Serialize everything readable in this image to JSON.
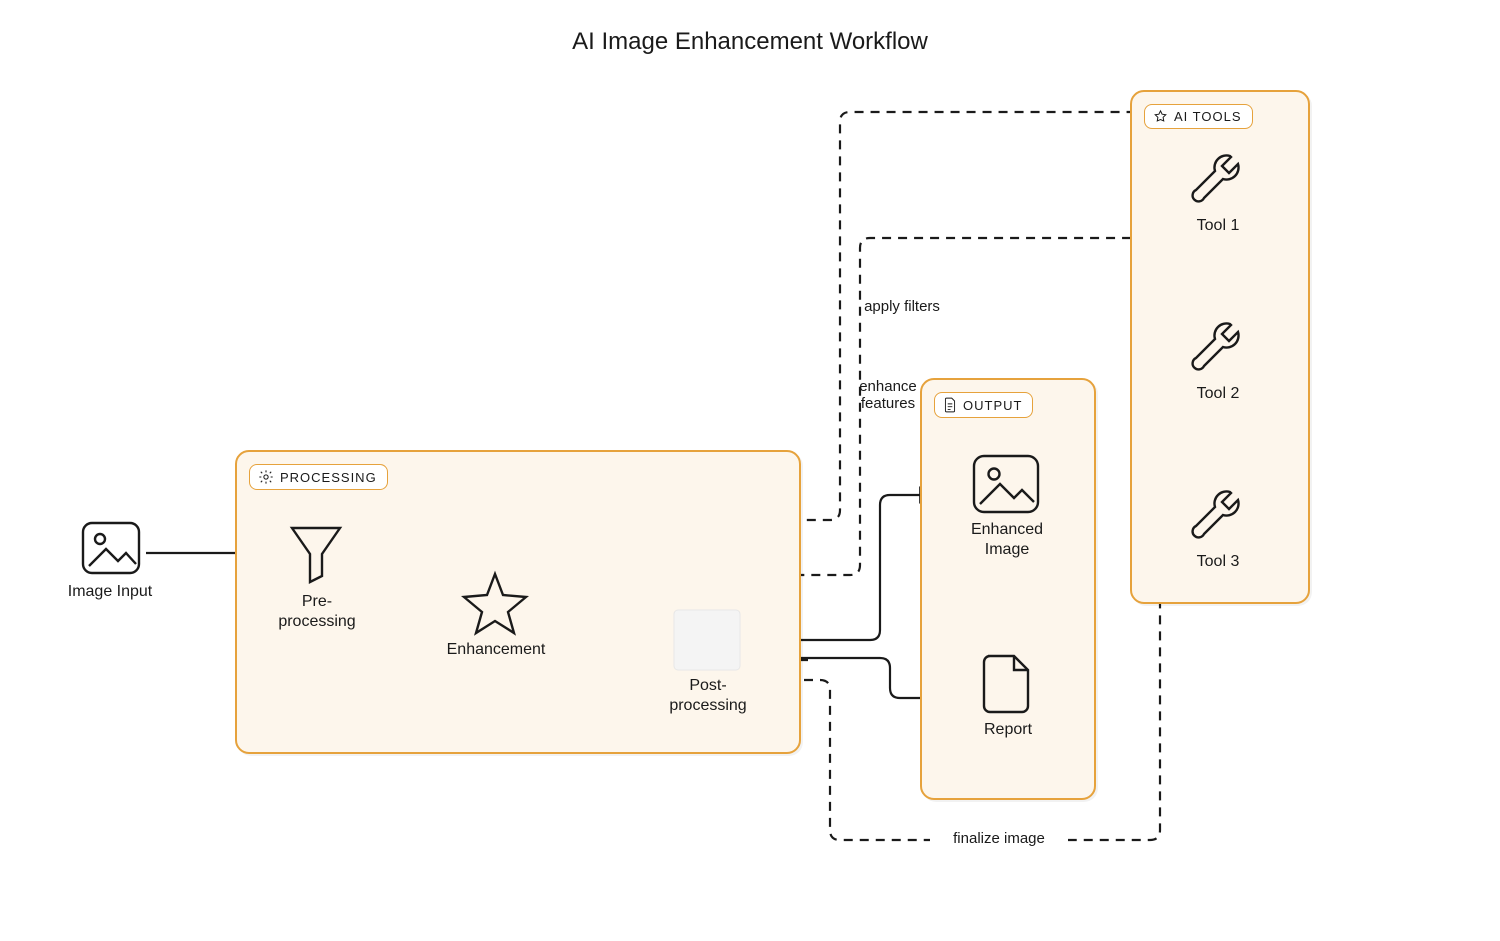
{
  "title": "AI Image Enhancement Workflow",
  "groups": {
    "processing": {
      "label": "PROCESSING"
    },
    "output": {
      "label": "OUTPUT"
    },
    "ai_tools": {
      "label": "AI TOOLS"
    }
  },
  "nodes": {
    "image_input": {
      "label": "Image Input"
    },
    "pre_processing": {
      "label": "Pre-\nprocessing"
    },
    "enhancement": {
      "label": "Enhancement"
    },
    "post_processing": {
      "label": "Post-\nprocessing"
    },
    "enhanced_image": {
      "label": "Enhanced\nImage"
    },
    "report": {
      "label": "Report"
    },
    "tool1": {
      "label": "Tool 1"
    },
    "tool2": {
      "label": "Tool 2"
    },
    "tool3": {
      "label": "Tool 3"
    }
  },
  "edges": {
    "apply_filters": {
      "label": "apply filters"
    },
    "enhance_features": {
      "label": "enhance\nfeatures"
    },
    "finalize_image": {
      "label": "finalize image"
    }
  },
  "colors": {
    "group_border": "#e6a23c",
    "group_fill": "#fdf6ec",
    "stroke": "#1a1a1a"
  }
}
